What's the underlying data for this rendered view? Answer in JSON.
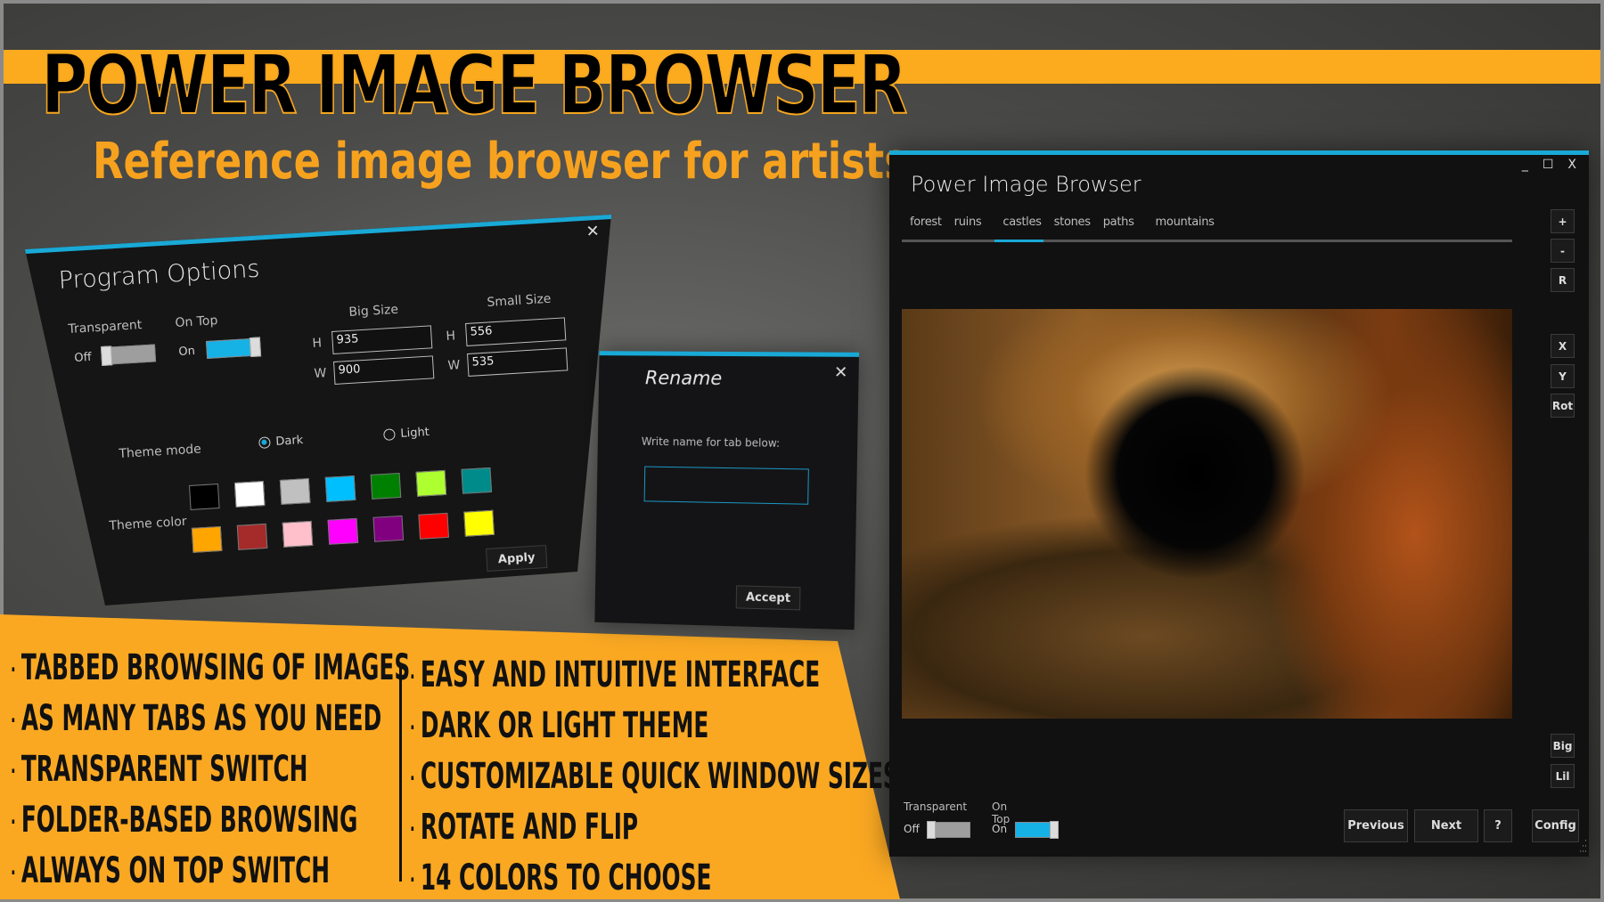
{
  "banner": {
    "title": "POWER IMAGE BROWSER",
    "subtitle": "Reference image browser for artists",
    "accent_color": "#fbab1d"
  },
  "features": {
    "bullet": "·",
    "left": [
      "Tabbed browsing of images",
      "As many tabs as you need",
      "Transparent switch",
      "Folder-based browsing",
      "Always on top switch"
    ],
    "right": [
      "Easy and intuitive interface",
      "Dark or light theme",
      "Customizable quick window sizes",
      "Rotate and flip",
      "14 colors to choose"
    ]
  },
  "program_options": {
    "title": "Program Options",
    "close_icon": "close-icon",
    "transparent": {
      "label": "Transparent",
      "state_label": "Off",
      "value": false
    },
    "on_top": {
      "label": "On Top",
      "state_label": "On",
      "value": true
    },
    "big_size": {
      "label": "Big Size",
      "h_label": "H",
      "h_value": "935",
      "w_label": "W",
      "w_value": "900"
    },
    "small_size": {
      "label": "Small Size",
      "h_label": "H",
      "h_value": "556",
      "w_label": "W",
      "w_value": "535"
    },
    "theme_mode": {
      "label": "Theme mode",
      "options": [
        "Dark",
        "Light"
      ],
      "selected": "Dark"
    },
    "theme_color": {
      "label": "Theme color",
      "colors": [
        "#000000",
        "#ffffff",
        "#c0c0c0",
        "#00bfff",
        "#008000",
        "#adff2f",
        "#008b8b",
        "#ffa500",
        "#a52a2a",
        "#ffc0cb",
        "#ff00ff",
        "#800080",
        "#ff0000",
        "#ffff00"
      ]
    },
    "apply_label": "Apply",
    "accent_color": "#19a9d6"
  },
  "rename_dialog": {
    "title": "Rename",
    "close_icon": "close-icon",
    "prompt": "Write name for tab below:",
    "input_value": "",
    "accept_label": "Accept"
  },
  "main_window": {
    "title": "Power Image Browser",
    "controls": {
      "minimize": "_",
      "maximize": "☐",
      "close": "X"
    },
    "tabs": [
      {
        "label": "forest",
        "active": false
      },
      {
        "label": "ruins",
        "active": false
      },
      {
        "label": "castles",
        "active": true
      },
      {
        "label": "stones",
        "active": false
      },
      {
        "label": "paths",
        "active": false
      },
      {
        "label": "mountains",
        "active": false
      }
    ],
    "image_alt": "Illuminated underground stone tunnel with arched entrance",
    "side_buttons": {
      "zoom_in": "+",
      "zoom_out": "-",
      "reset": "R",
      "flip_x": "X",
      "flip_y": "Y",
      "rotate": "Rot",
      "big": "Big",
      "lil": "Lil"
    },
    "transparent": {
      "label": "Transparent",
      "state_label": "Off",
      "value": false
    },
    "on_top": {
      "label": "On Top",
      "state_label": "On",
      "value": true
    },
    "nav": {
      "previous": "Previous",
      "next": "Next",
      "help": "?",
      "config": "Config"
    }
  }
}
